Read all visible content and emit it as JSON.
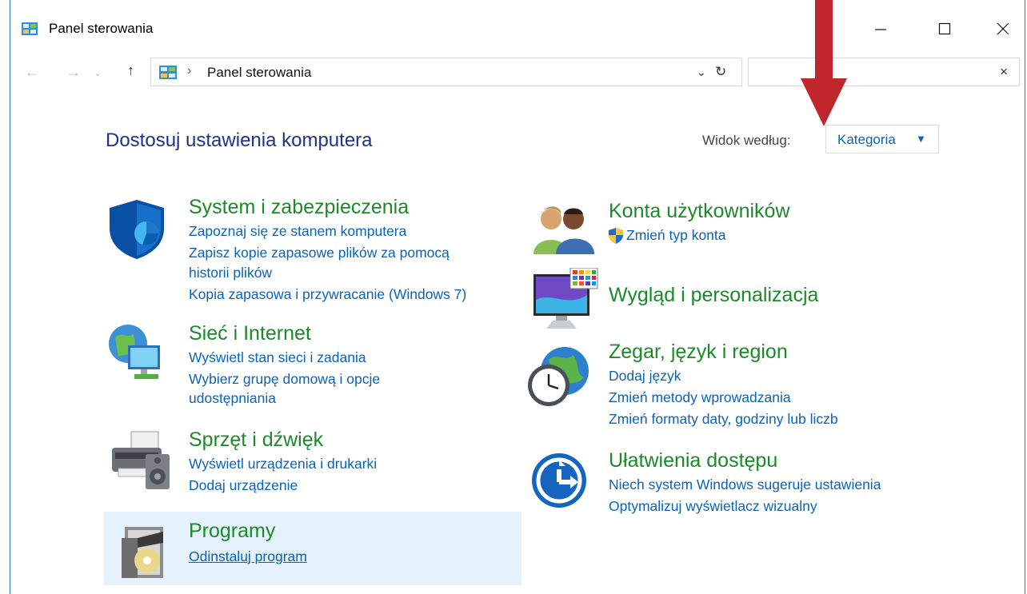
{
  "window": {
    "title": "Panel sterowania"
  },
  "address": {
    "path": "Panel sterowania",
    "separator": "›"
  },
  "search": {
    "value": ""
  },
  "heading": "Dostosuj ustawienia komputera",
  "view": {
    "label": "Widok według:",
    "selected": "Kategoria"
  },
  "categories": {
    "system": {
      "title": "System i zabezpieczenia",
      "links": [
        "Zapoznaj się ze stanem komputera",
        "Zapisz kopie zapasowe plików za pomocą",
        "historii plików",
        "Kopia zapasowa i przywracanie (Windows 7)"
      ]
    },
    "network": {
      "title": "Sieć i Internet",
      "links": [
        "Wyświetl stan sieci i zadania",
        "Wybierz grupę domową i opcje",
        "udostępniania"
      ]
    },
    "hardware": {
      "title": "Sprzęt i dźwięk",
      "links": [
        "Wyświetl urządzenia i drukarki",
        "Dodaj urządzenie"
      ]
    },
    "programs": {
      "title": "Programy",
      "links": [
        "Odinstaluj program"
      ]
    },
    "accounts": {
      "title": "Konta użytkowników",
      "links": [
        "Zmień typ konta"
      ]
    },
    "appearance": {
      "title": "Wygląd i personalizacja"
    },
    "clock": {
      "title": "Zegar, język i region",
      "links": [
        "Dodaj język",
        "Zmień metody wprowadzania",
        "Zmień formaty daty, godziny lub liczb"
      ]
    },
    "ease": {
      "title": "Ułatwienia dostępu",
      "links": [
        "Niech system Windows sugeruje ustawienia",
        "Optymalizuj wyświetlacz wizualny"
      ]
    }
  },
  "colors": {
    "link": "#0a63b8",
    "category": "#1b8a28",
    "heading": "#1e3287",
    "highlight": "#e5f1fb",
    "annotation": "#c0272d"
  }
}
